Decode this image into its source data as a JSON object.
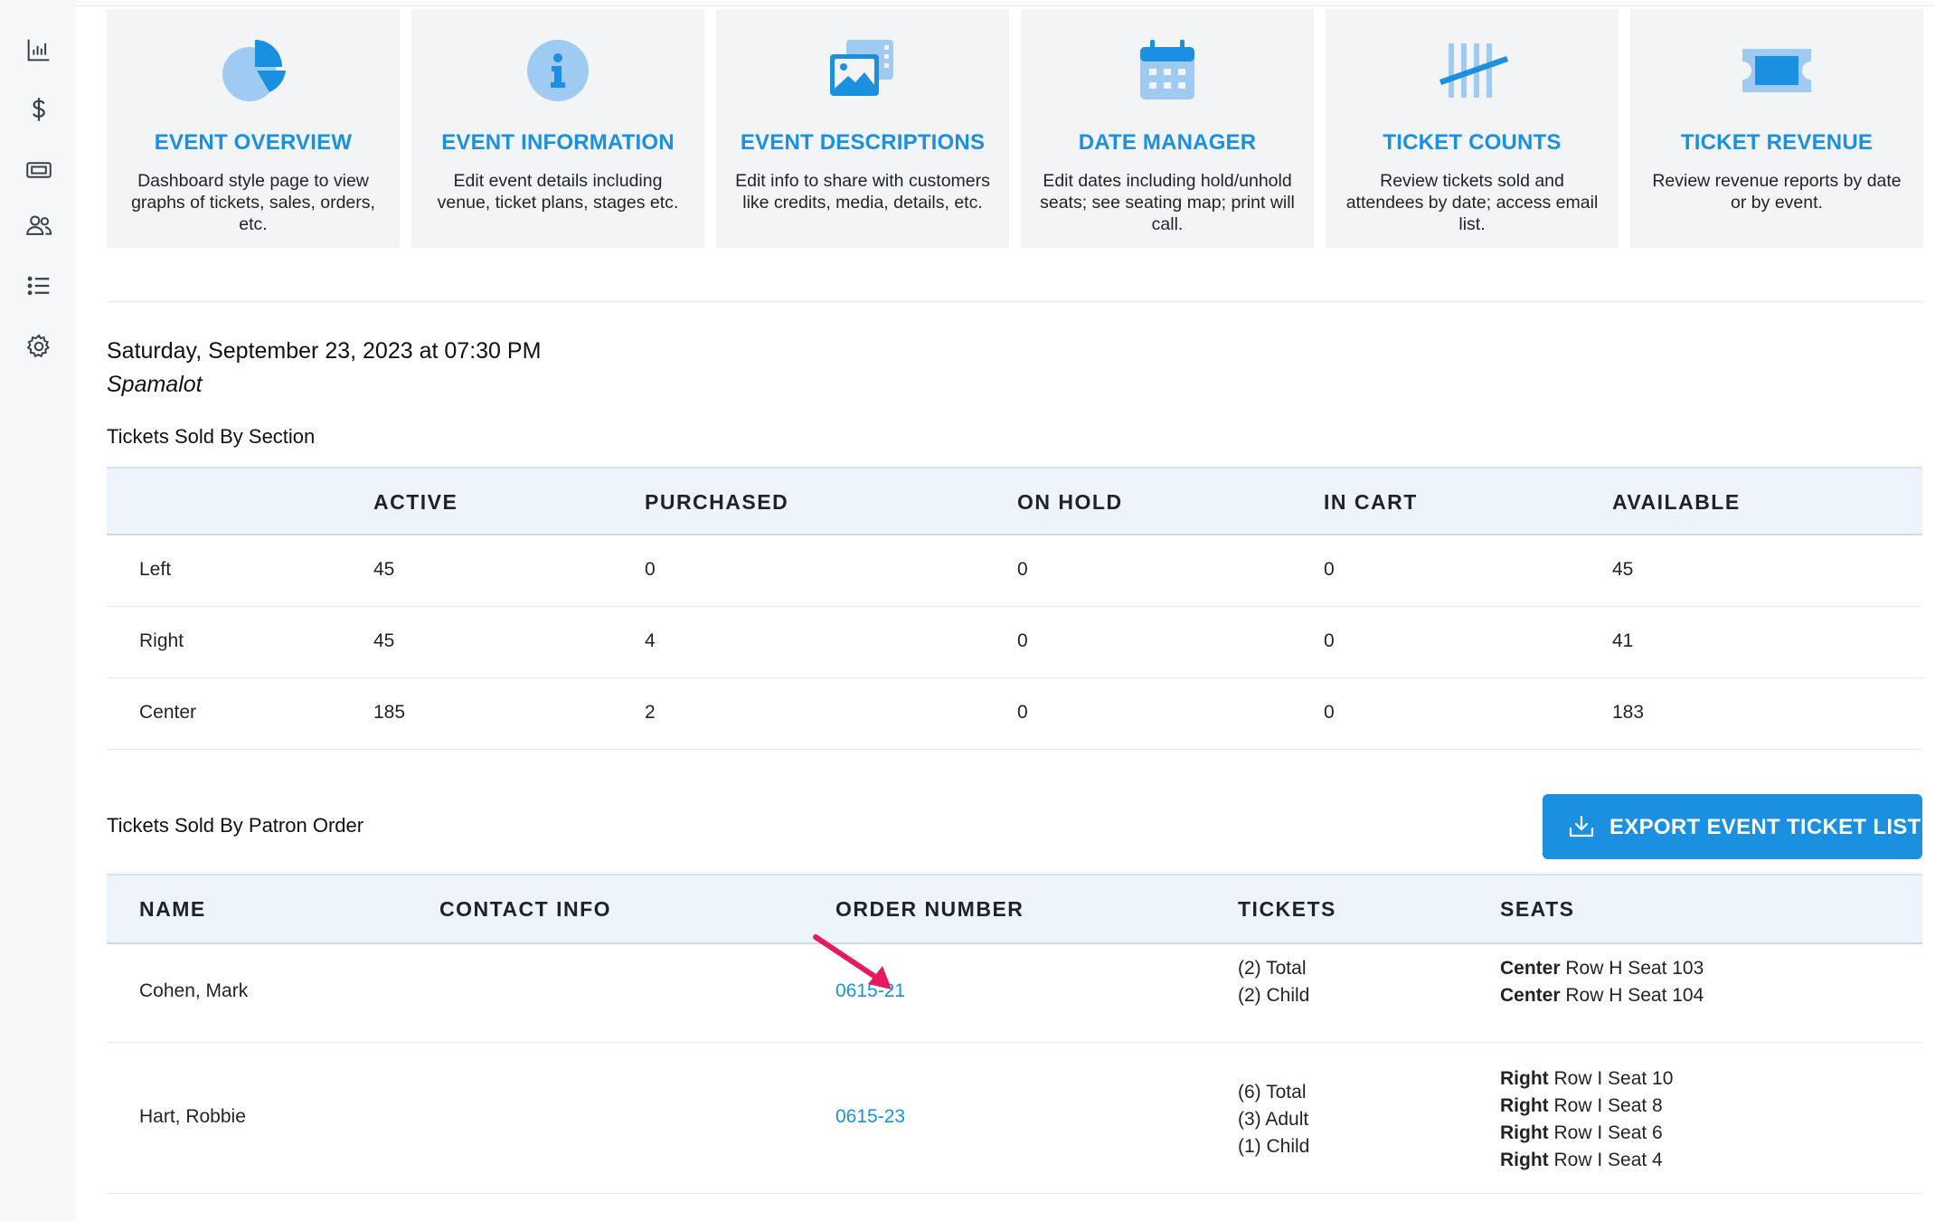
{
  "sidebar": {
    "items": [
      {
        "icon": "bar-chart-icon"
      },
      {
        "icon": "dollar-icon"
      },
      {
        "icon": "ticket-icon"
      },
      {
        "icon": "users-icon"
      },
      {
        "icon": "list-icon"
      },
      {
        "icon": "gear-icon"
      }
    ]
  },
  "cards": [
    {
      "title": "EVENT OVERVIEW",
      "desc": "Dashboard style page to view graphs of tickets, sales, orders, etc.",
      "icon": "pie-chart-icon"
    },
    {
      "title": "EVENT INFORMATION",
      "desc": "Edit event details including venue, ticket plans, stages etc.",
      "icon": "info-icon"
    },
    {
      "title": "EVENT DESCRIPTIONS",
      "desc": "Edit info to share with customers like credits, media, details, etc.",
      "icon": "images-icon"
    },
    {
      "title": "DATE MANAGER",
      "desc": "Edit dates including hold/unhold seats; see seating map; print will call.",
      "icon": "calendar-icon"
    },
    {
      "title": "TICKET COUNTS",
      "desc": "Review tickets sold and attendees by date; access email list.",
      "icon": "tally-icon"
    },
    {
      "title": "TICKET REVENUE",
      "desc": "Review revenue reports by date or by event.",
      "icon": "ticket-icon"
    }
  ],
  "event": {
    "datetime": "Saturday, September 23, 2023 at 07:30 PM",
    "show": "Spamalot"
  },
  "section_table": {
    "label": "Tickets Sold By Section",
    "headers": [
      "ACTIVE",
      "PURCHASED",
      "ON HOLD",
      "IN CART",
      "AVAILABLE"
    ],
    "rows": [
      {
        "name": "Left",
        "active": "45",
        "purchased": "0",
        "on_hold": "0",
        "in_cart": "0",
        "available": "45"
      },
      {
        "name": "Right",
        "active": "45",
        "purchased": "4",
        "on_hold": "0",
        "in_cart": "0",
        "available": "41"
      },
      {
        "name": "Center",
        "active": "185",
        "purchased": "2",
        "on_hold": "0",
        "in_cart": "0",
        "available": "183"
      }
    ]
  },
  "patron_table": {
    "label": "Tickets Sold By Patron Order",
    "export_label": "EXPORT EVENT TICKET LIST",
    "headers": [
      "NAME",
      "CONTACT INFO",
      "ORDER NUMBER",
      "TICKETS",
      "SEATS"
    ],
    "rows": [
      {
        "name": "Cohen, Mark",
        "contact": "",
        "order": "0615-21",
        "tickets": [
          "(2) Total",
          "(2) Child"
        ],
        "seats": [
          {
            "section": "Center",
            "detail": " Row H Seat 103"
          },
          {
            "section": "Center",
            "detail": " Row H Seat 104"
          }
        ]
      },
      {
        "name": "Hart, Robbie",
        "contact": "",
        "order": "0615-23",
        "tickets": [
          "(6) Total",
          "(3) Adult",
          "(1) Child"
        ],
        "seats": [
          {
            "section": "Right",
            "detail": " Row I Seat 10"
          },
          {
            "section": "Right",
            "detail": " Row I Seat 8"
          },
          {
            "section": "Right",
            "detail": " Row I Seat 6"
          },
          {
            "section": "Right",
            "detail": " Row I Seat 4"
          }
        ]
      }
    ]
  },
  "colors": {
    "accent": "#1b8fe0",
    "arrow": "#e5195e",
    "header_bg": "#eef4fb"
  }
}
